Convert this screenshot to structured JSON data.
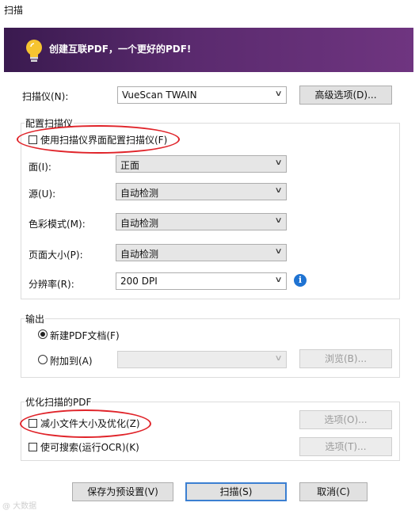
{
  "window": {
    "title": "扫描"
  },
  "banner": {
    "text": "创建互联PDF，一个更好的PDF!"
  },
  "scanner": {
    "label": "扫描仪(N):",
    "value": "VueScan TWAIN",
    "advanced_button": "高级选项(D)..."
  },
  "config": {
    "group_label": "配置扫描仪",
    "use_ui_checkbox": {
      "label": "使用扫描仪界面配置扫描仪(F)",
      "checked": false
    },
    "face": {
      "label": "面(I):",
      "value": "正面"
    },
    "source": {
      "label": "源(U):",
      "value": "自动检测"
    },
    "color_mode": {
      "label": "色彩模式(M):",
      "value": "自动检测"
    },
    "page_size": {
      "label": "页面大小(P):",
      "value": "自动检测"
    },
    "resolution": {
      "label": "分辨率(R):",
      "value": "200  DPI"
    }
  },
  "output": {
    "group_label": "输出",
    "new_pdf": {
      "label": "新建PDF文档(F)",
      "selected": true
    },
    "append": {
      "label": "附加到(A)",
      "selected": false
    },
    "browse_button": "浏览(B)..."
  },
  "optimize": {
    "group_label": "优化扫描的PDF",
    "reduce": {
      "label": "减小文件大小及优化(Z)",
      "checked": false
    },
    "reduce_options": "选项(O)...",
    "searchable": {
      "label": "使可搜索(运行OCR)(K)",
      "checked": false
    },
    "searchable_options": "选项(T)..."
  },
  "footer": {
    "save_preset": "保存为预设置(V)",
    "scan": "扫描(S)",
    "cancel": "取消(C)"
  },
  "watermark": {
    "text": "@ 大数据"
  },
  "colors": {
    "banner_start": "#3a1a4f",
    "banner_end": "#6f3580",
    "highlight_ellipse": "#e0242a",
    "info_icon": "#1f73d2",
    "default_button_border": "#3b7fd1"
  },
  "icons": {
    "banner": "lightbulb-icon",
    "dropdown": "chevron-down-icon",
    "info": "info-icon"
  }
}
